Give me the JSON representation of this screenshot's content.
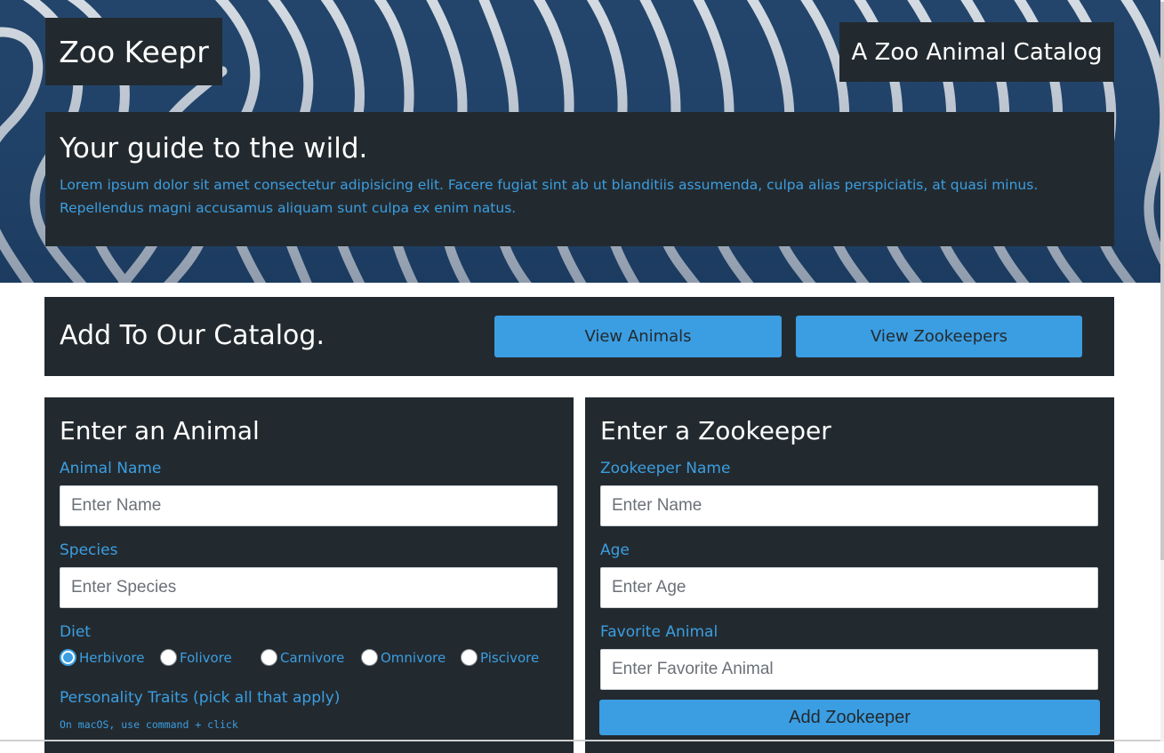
{
  "header": {
    "brand": "Zoo Keepr",
    "tagline": "A Zoo Animal Catalog"
  },
  "intro": {
    "title": "Your guide to the wild.",
    "body": "Lorem ipsum dolor sit amet consectetur adipisicing elit. Facere fugiat sint ab ut blanditiis assumenda, culpa alias perspiciatis, at quasi minus. Repellendus magni accusamus aliquam sunt culpa ex enim natus."
  },
  "catalog": {
    "title": "Add To Our Catalog.",
    "view_animals": "View Animals",
    "view_zookeepers": "View Zookeepers"
  },
  "animal_form": {
    "title": "Enter an Animal",
    "name_label": "Animal Name",
    "name_placeholder": "Enter Name",
    "species_label": "Species",
    "species_placeholder": "Enter Species",
    "diet_label": "Diet",
    "diet_options": [
      "Herbivore",
      "Folivore",
      "Carnivore",
      "Omnivore",
      "Piscivore"
    ],
    "diet_selected": "Herbivore",
    "traits_label": "Personality Traits (pick all that apply)",
    "traits_hint": "On macOS, use command + click"
  },
  "zookeeper_form": {
    "title": "Enter a Zookeeper",
    "name_label": "Zookeeper Name",
    "name_placeholder": "Enter Name",
    "age_label": "Age",
    "age_placeholder": "Enter Age",
    "favorite_label": "Favorite Animal",
    "favorite_placeholder": "Enter Favorite Animal",
    "submit_label": "Add Zookeeper"
  },
  "colors": {
    "panel": "#232a2f",
    "accent": "#3b9ee2",
    "hero_stripe_dark": "#23456b",
    "hero_stripe_light": "#e9ecef"
  }
}
